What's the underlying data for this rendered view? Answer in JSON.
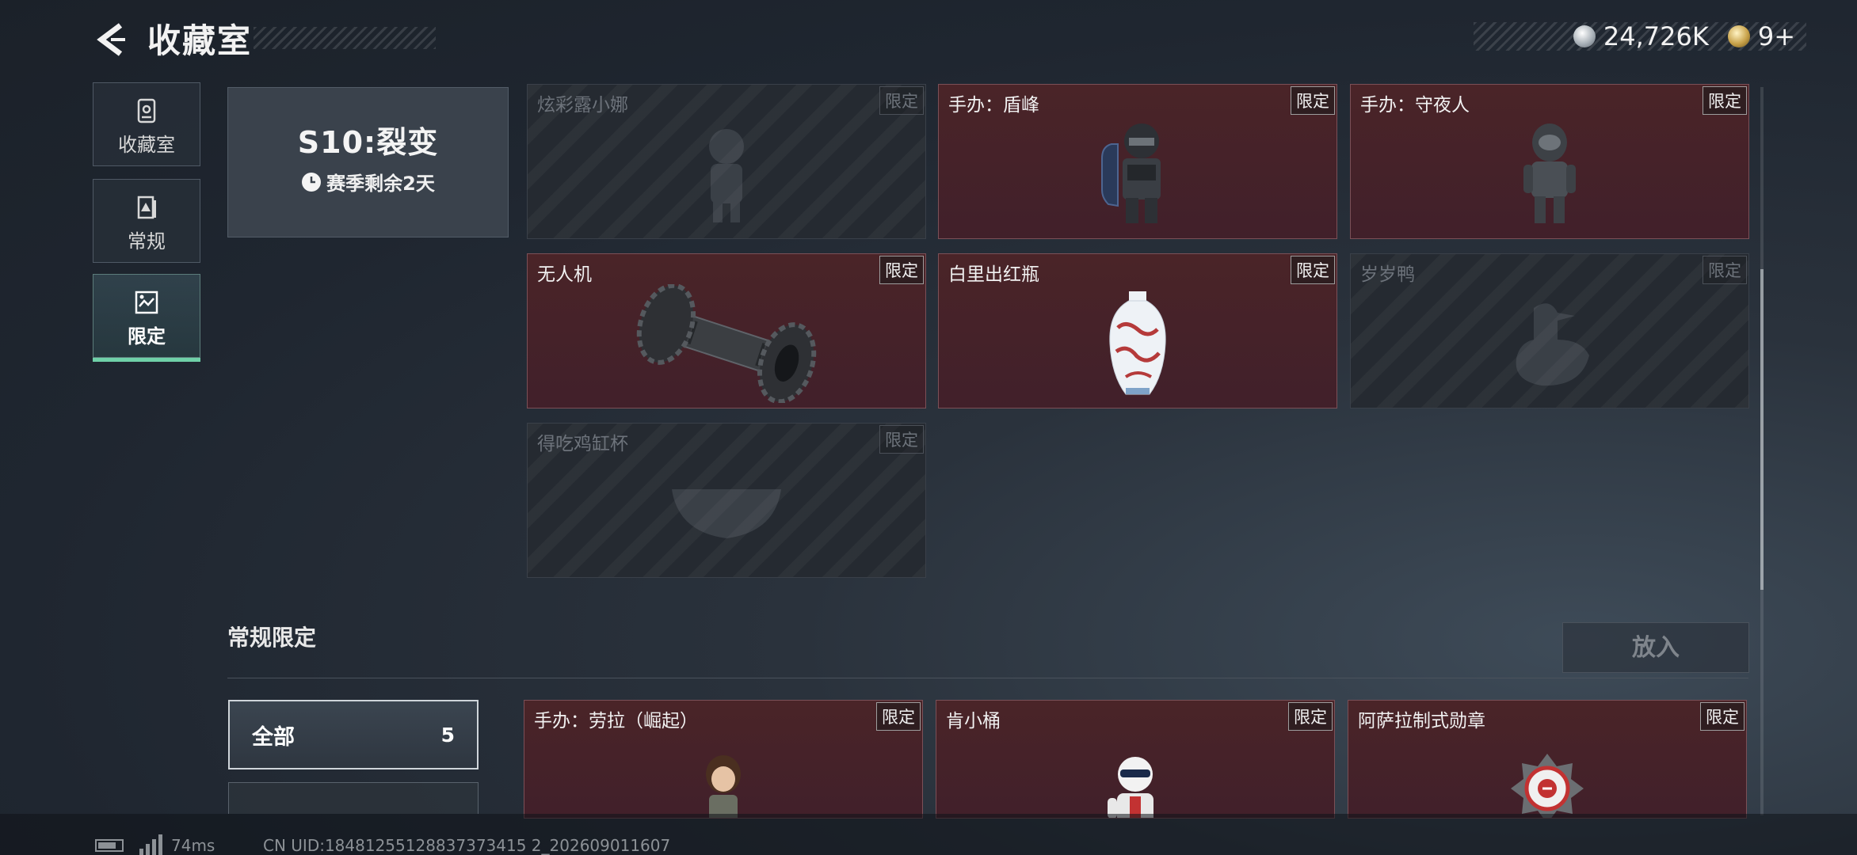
{
  "header": {
    "title": "收藏室",
    "currency_silver": "24,726K",
    "currency_gold": "9+"
  },
  "nav": [
    {
      "label": "收藏室",
      "icon": "collection-icon",
      "active": false
    },
    {
      "label": "常规",
      "icon": "regular-icon",
      "active": false
    },
    {
      "label": "限定",
      "icon": "limited-icon",
      "active": true
    }
  ],
  "season": {
    "title": "S10:裂变",
    "remaining": "赛季剩余2天"
  },
  "season_items": [
    {
      "name": "炫彩露小娜",
      "tag": "限定",
      "owned": false,
      "icon": "figure-icon"
    },
    {
      "name": "手办：盾峰",
      "tag": "限定",
      "owned": true,
      "icon": "shield-soldier-figure-icon"
    },
    {
      "name": "手办：守夜人",
      "tag": "限定",
      "owned": true,
      "icon": "nightwatch-figure-icon"
    },
    {
      "name": "无人机",
      "tag": "限定",
      "owned": true,
      "icon": "drone-roller-icon"
    },
    {
      "name": "白里出红瓶",
      "tag": "限定",
      "owned": true,
      "icon": "porcelain-vase-icon"
    },
    {
      "name": "岁岁鸭",
      "tag": "限定",
      "owned": false,
      "icon": "duck-icon"
    },
    {
      "name": "得吃鸡缸杯",
      "tag": "限定",
      "owned": false,
      "icon": "bowl-icon"
    }
  ],
  "regular_section": {
    "title": "常规限定",
    "put_button": "放入",
    "filter_all_label": "全部",
    "filter_all_count": "5"
  },
  "regular_items": [
    {
      "name": "手办：劳拉（崛起）",
      "tag": "限定",
      "owned": true,
      "icon": "lara-figure-icon"
    },
    {
      "name": "肯小桶",
      "tag": "限定",
      "owned": true,
      "icon": "colonel-figure-icon"
    },
    {
      "name": "阿萨拉制式勋章",
      "tag": "限定",
      "owned": true,
      "icon": "medal-icon"
    }
  ],
  "footer": {
    "ping": "74ms",
    "uid": "CN UID:18481255128837373415 2_202609011607"
  },
  "colors": {
    "owned_card": "#4a2428",
    "locked_card": "#252a31",
    "active_nav_underline": "#6fd0a8"
  }
}
